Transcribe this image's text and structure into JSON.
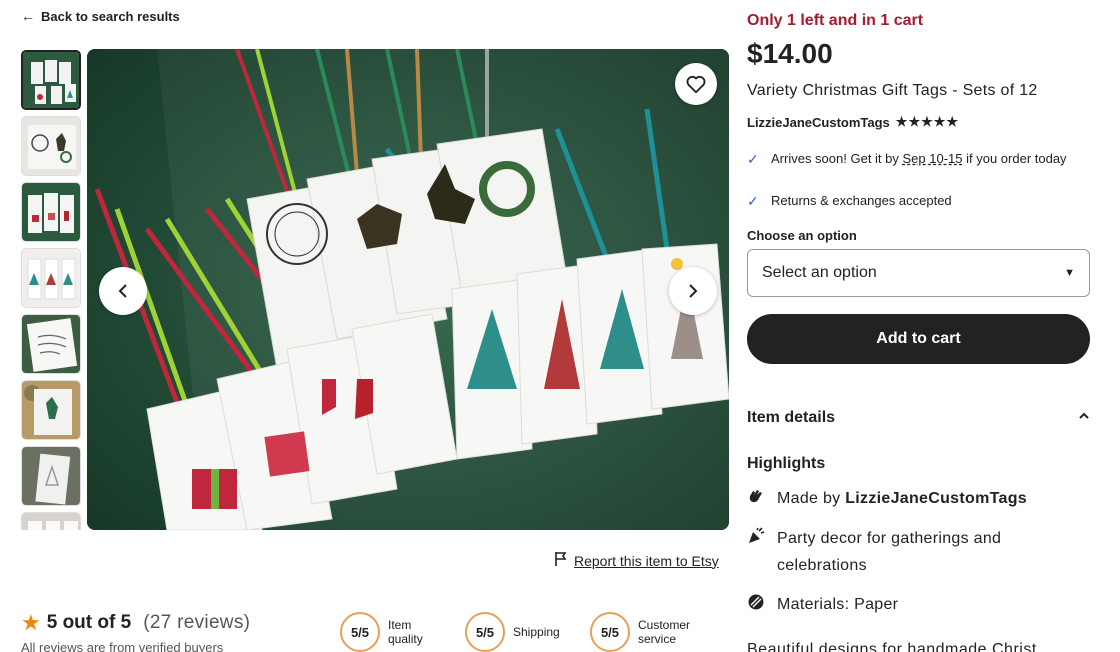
{
  "nav": {
    "back_label": "Back to search results"
  },
  "gallery": {
    "thumbnail_count": 8,
    "favorite_icon": "heart-icon",
    "prev_icon": "chevron-left-icon",
    "next_icon": "chevron-right-icon"
  },
  "report": {
    "label": "Report this item to Etsy"
  },
  "reviews": {
    "score": "5 out of 5",
    "count": "(27 reviews)",
    "verified_note": "All reviews are from verified buyers",
    "metrics": [
      {
        "score": "5/5",
        "label_line1": "Item",
        "label_line2": "quality"
      },
      {
        "score": "5/5",
        "label_line1": "Shipping",
        "label_line2": ""
      },
      {
        "score": "5/5",
        "label_line1": "Customer",
        "label_line2": "service"
      }
    ]
  },
  "product": {
    "stock_notice": "Only 1 left and in 1 cart",
    "price": "$14.00",
    "title": "Variety Christmas Gift Tags - Sets of 12",
    "shop_name": "LizzieJaneCustomTags",
    "rating_stars": 5,
    "arrival_prefix": "Arrives soon! Get it by ",
    "arrival_date": "Sep 10-15",
    "arrival_suffix": " if you order today",
    "returns": "Returns & exchanges accepted",
    "option_label": "Choose an option",
    "option_placeholder": "Select an option",
    "add_to_cart": "Add to cart",
    "item_details": "Item details",
    "highlights_title": "Highlights",
    "made_by_prefix": "Made by ",
    "made_by_shop": "LizzieJaneCustomTags",
    "party_decor": "Party decor for gatherings and celebrations",
    "materials": "Materials: Paper",
    "description_start": "Beautiful designs for handmade Christ"
  },
  "colors": {
    "stock": "#a61a2e",
    "check": "#2f5fd0",
    "review_star": "#e6890f",
    "metric_ring": "#e6a157"
  }
}
